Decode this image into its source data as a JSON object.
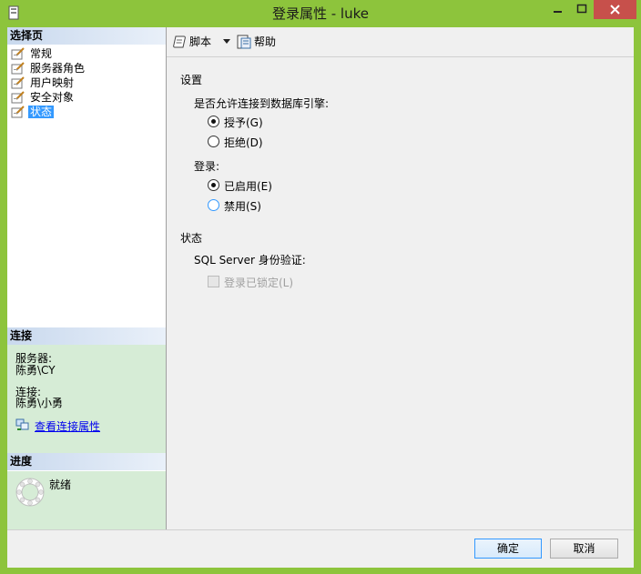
{
  "window": {
    "title": "登录属性 - luke"
  },
  "left": {
    "pages_header": "选择页",
    "pages": [
      {
        "label": "常规",
        "selected": false
      },
      {
        "label": "服务器角色",
        "selected": false
      },
      {
        "label": "用户映射",
        "selected": false
      },
      {
        "label": "安全对象",
        "selected": false
      },
      {
        "label": "状态",
        "selected": true
      }
    ],
    "connection_header": "连接",
    "server_label": "服务器:",
    "server_value": "陈勇\\CY",
    "connection_label": "连接:",
    "connection_value": "陈勇\\小勇",
    "view_link": "查看连接属性",
    "progress_header": "进度",
    "progress_status": "就绪"
  },
  "toolbar": {
    "script": "脚本",
    "help": "帮助"
  },
  "settings": {
    "section": "设置",
    "permission_question": "是否允许连接到数据库引擎:",
    "grant": "授予(G)",
    "deny": "拒绝(D)",
    "login_label": "登录:",
    "enabled": "已启用(E)",
    "disabled": "禁用(S)"
  },
  "status": {
    "section": "状态",
    "auth_label": "SQL Server 身份验证:",
    "locked": "登录已锁定(L)"
  },
  "buttons": {
    "ok": "确定",
    "cancel": "取消"
  }
}
